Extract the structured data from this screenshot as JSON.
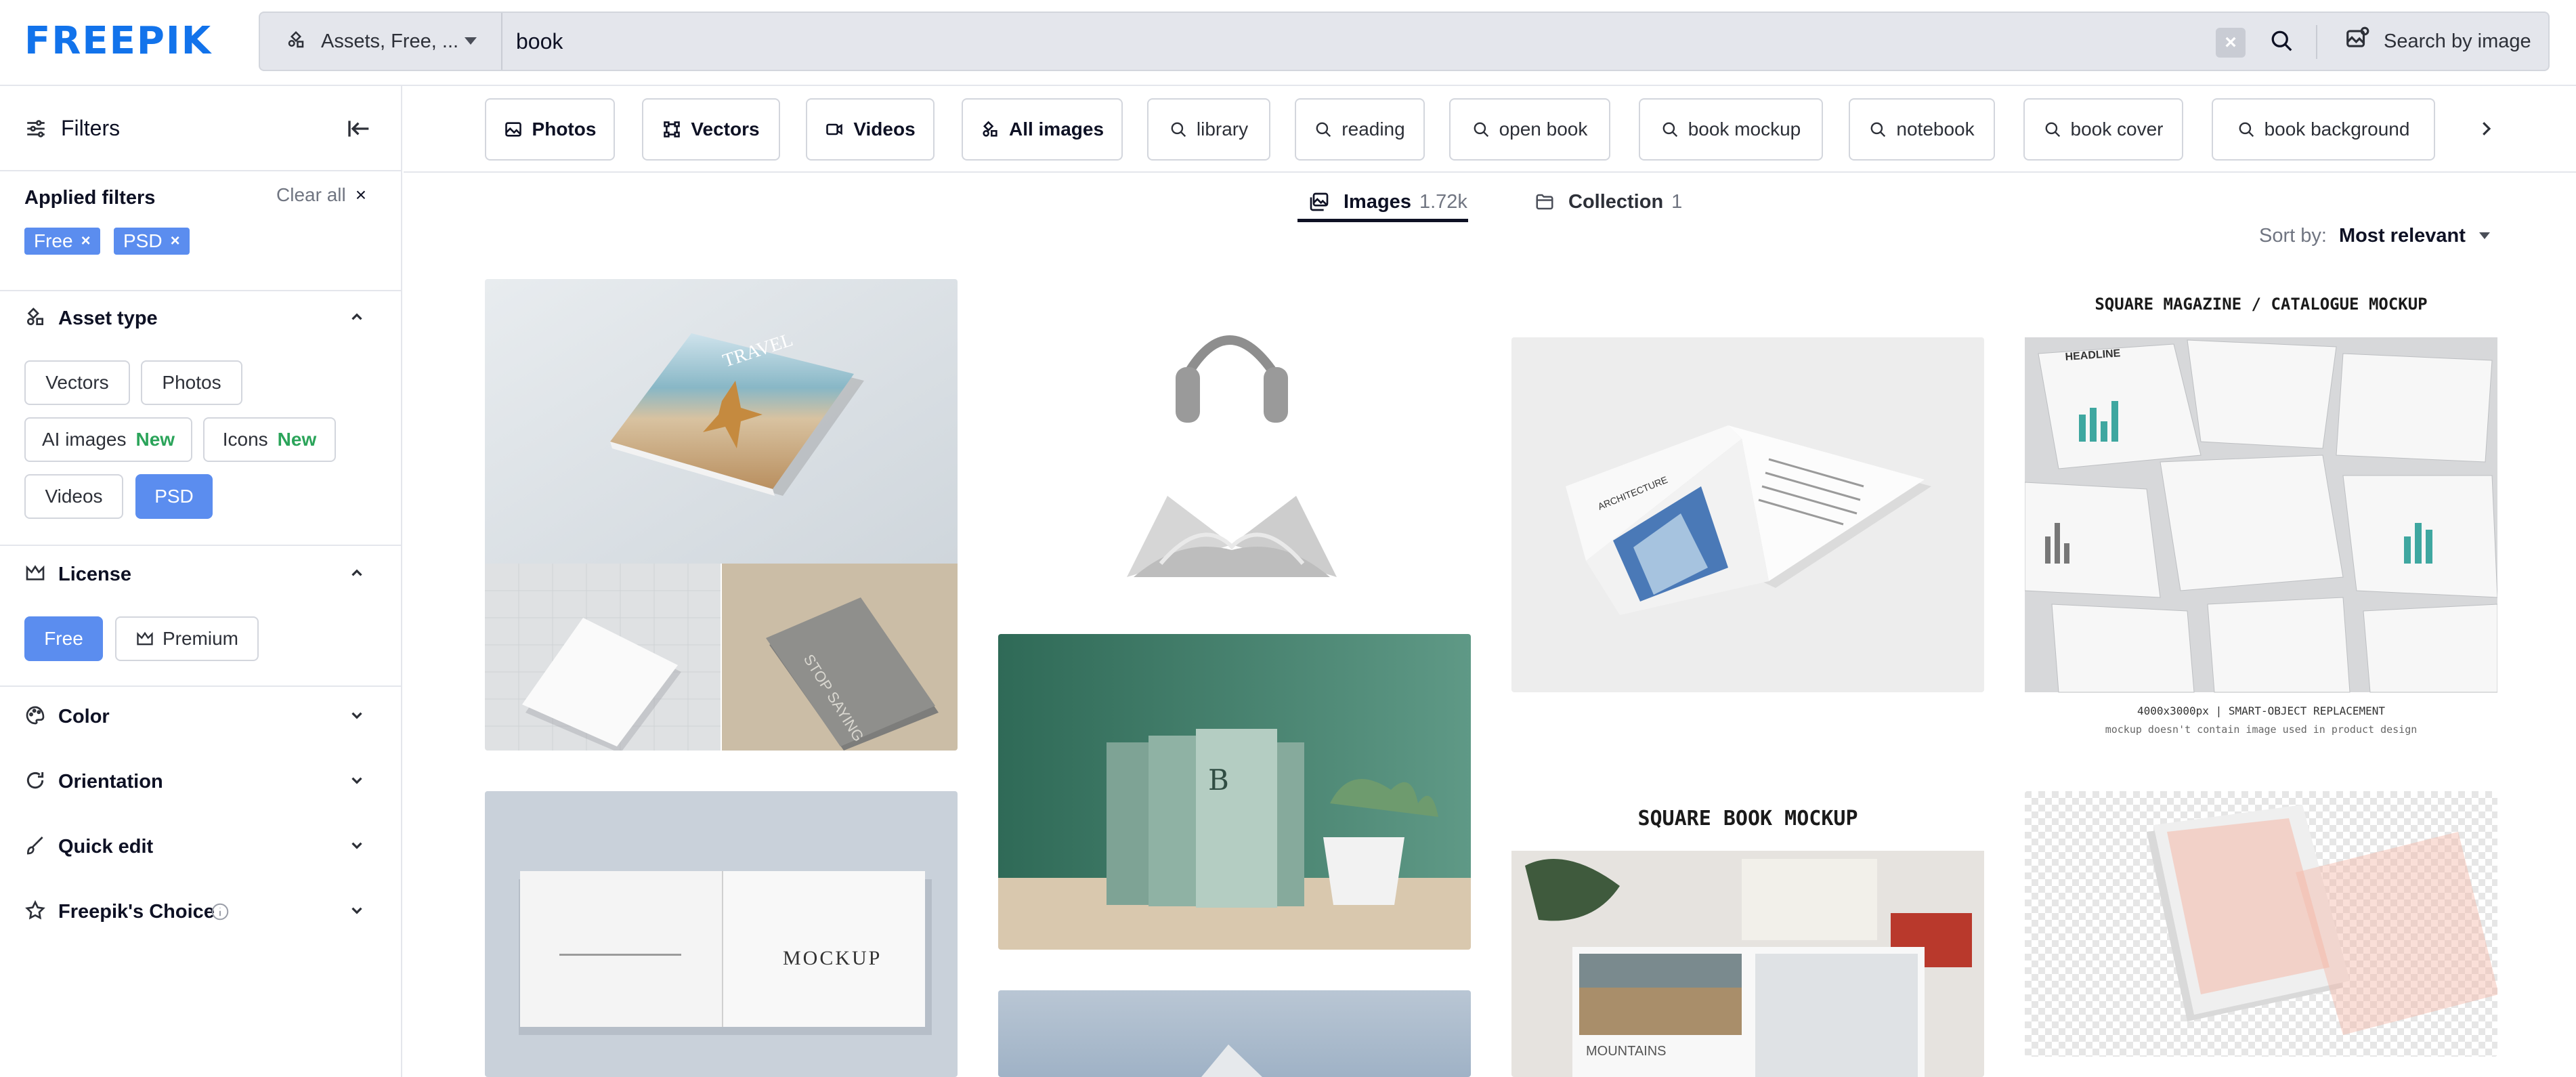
{
  "header": {
    "logo": "FREEPIK",
    "asset_select": "Assets, Free, ...",
    "search_query": "book",
    "search_by_image": "Search by image"
  },
  "sidebar": {
    "title": "Filters",
    "applied": {
      "title": "Applied filters",
      "clear_all": "Clear all",
      "chips": [
        "Free",
        "PSD"
      ]
    },
    "asset_type": {
      "title": "Asset type",
      "options": {
        "vectors": "Vectors",
        "photos": "Photos",
        "ai_images": "AI images",
        "icons": "Icons",
        "new": "New",
        "videos": "Videos",
        "psd": "PSD"
      },
      "selected": "PSD"
    },
    "license": {
      "title": "License",
      "free": "Free",
      "premium": "Premium",
      "selected": "Free"
    },
    "sections": {
      "color": "Color",
      "orientation": "Orientation",
      "quick_edit": "Quick edit",
      "freepiks_choice": "Freepik's Choice"
    }
  },
  "categories": {
    "photos": "Photos",
    "vectors": "Vectors",
    "videos": "Videos",
    "all_images": "All images",
    "suggestions": [
      "library",
      "reading",
      "open book",
      "book mockup",
      "notebook",
      "book cover",
      "book background"
    ]
  },
  "tabs": {
    "images": {
      "label": "Images",
      "count": "1.72k"
    },
    "collection": {
      "label": "Collection",
      "count": "1"
    }
  },
  "sort": {
    "label": "Sort by:",
    "value": "Most relevant"
  },
  "results": {
    "card_texts": {
      "travel": "TRAVEL",
      "stop_saying": "STOP SAYING",
      "architecture": "ARCHITECTURE",
      "square_mag_title": "SQUARE MAGAZINE / CATALOGUE MOCKUP",
      "square_mag_cap1": "4000x3000px | SMART-OBJECT REPLACEMENT",
      "square_mag_cap2": "mockup doesn't contain image used in product design",
      "mockup": "MOCKUP",
      "square_book_title": "SQUARE BOOK MOCKUP",
      "mountains": "MOUNTAINS",
      "headline": "HEADLINE"
    }
  },
  "colors": {
    "brand": "#1273eb",
    "chip": "#5b8def",
    "new_badge": "#2ba45a"
  }
}
